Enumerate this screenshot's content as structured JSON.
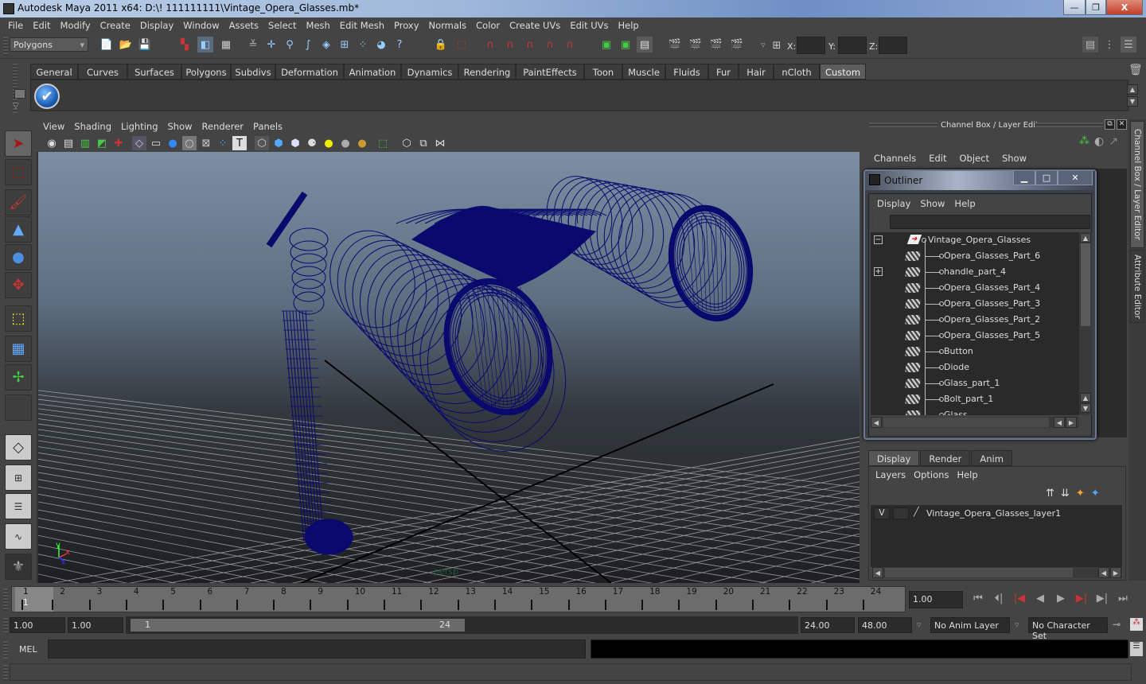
{
  "window": {
    "title": "Autodesk Maya 2011 x64: D:\\! 111111111\\Vintage_Opera_Glasses.mb*",
    "minimize": "—",
    "restore": "❐",
    "close": "X"
  },
  "menubar": [
    "File",
    "Edit",
    "Modify",
    "Create",
    "Display",
    "Window",
    "Assets",
    "Select",
    "Mesh",
    "Edit Mesh",
    "Proxy",
    "Normals",
    "Color",
    "Create UVs",
    "Edit UVs",
    "Help"
  ],
  "statusline": {
    "menuset": "Polygons",
    "x_label": "X:",
    "y_label": "Y:",
    "z_label": "Z:",
    "x_value": "",
    "y_value": "",
    "z_value": ""
  },
  "shelf": {
    "tabs": [
      "General",
      "Curves",
      "Surfaces",
      "Polygons",
      "Subdivs",
      "Deformation",
      "Animation",
      "Dynamics",
      "Rendering",
      "PaintEffects",
      "Toon",
      "Muscle",
      "Fluids",
      "Fur",
      "Hair",
      "nCloth",
      "Custom"
    ],
    "active_tab": "Custom"
  },
  "viewport": {
    "menu": [
      "View",
      "Shading",
      "Lighting",
      "Show",
      "Renderer",
      "Panels"
    ],
    "camera_label": "persp",
    "axis_labels": {
      "y": "y",
      "x": "x",
      "z": "z"
    },
    "wire_color": "#0a0a6e"
  },
  "channel_box": {
    "header": "Channel Box / Layer Editor",
    "menu": [
      "Channels",
      "Edit",
      "Object",
      "Show"
    ]
  },
  "side_tabs": [
    "Channel Box / Layer Editor",
    "Attribute Editor"
  ],
  "outliner": {
    "title": "Outliner",
    "menu": [
      "Display",
      "Show",
      "Help"
    ],
    "filter_value": "",
    "root": "Vintage_Opera_Glasses",
    "items": [
      {
        "label": "Opera_Glasses_Part_6",
        "expandable": false
      },
      {
        "label": "handle_part_4",
        "expandable": true
      },
      {
        "label": "Opera_Glasses_Part_4",
        "expandable": false
      },
      {
        "label": "Opera_Glasses_Part_3",
        "expandable": false
      },
      {
        "label": "Opera_Glasses_Part_2",
        "expandable": false
      },
      {
        "label": "Opera_Glasses_Part_5",
        "expandable": false
      },
      {
        "label": "Button",
        "expandable": false
      },
      {
        "label": "Diode",
        "expandable": false
      },
      {
        "label": "Glass_part_1",
        "expandable": false
      },
      {
        "label": "Bolt_part_1",
        "expandable": false
      },
      {
        "label": "Glass",
        "expandable": false
      }
    ]
  },
  "layer_editor": {
    "tabs": [
      "Display",
      "Render",
      "Anim"
    ],
    "active_tab": "Display",
    "menu": [
      "Layers",
      "Options",
      "Help"
    ],
    "layers": [
      {
        "visible": "V",
        "name": "Vintage_Opera_Glasses_layer1"
      }
    ]
  },
  "timeline": {
    "frames": [
      "1",
      "2",
      "3",
      "4",
      "5",
      "6",
      "7",
      "8",
      "9",
      "10",
      "11",
      "12",
      "13",
      "14",
      "15",
      "16",
      "17",
      "18",
      "19",
      "20",
      "21",
      "22",
      "23",
      "24"
    ],
    "current_frame_marker": "1",
    "current_time": "1.00"
  },
  "range": {
    "anim_start": "1.00",
    "playback_start": "1.00",
    "slider_start": "1",
    "slider_end": "24",
    "playback_end": "24.00",
    "anim_end": "48.00",
    "anim_layer": "No Anim Layer",
    "character_set": "No Character Set"
  },
  "command_line": {
    "label": "MEL",
    "input_value": "",
    "result": ""
  },
  "help_line": ""
}
